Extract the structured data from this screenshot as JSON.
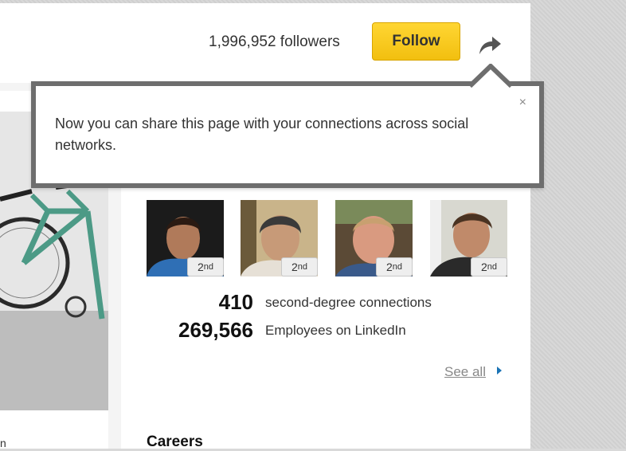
{
  "header": {
    "followers_text": "1,996,952 followers",
    "follow_label": "Follow",
    "share_icon": "share-arrow-icon"
  },
  "tooltip": {
    "message": "Now you can share this page with your connections across social networks.",
    "close_label": "×"
  },
  "connections": {
    "avatars": [
      {
        "badge_num": "2",
        "badge_suffix": "nd"
      },
      {
        "badge_num": "2",
        "badge_suffix": "nd"
      },
      {
        "badge_num": "2",
        "badge_suffix": "nd"
      },
      {
        "badge_num": "2",
        "badge_suffix": "nd"
      }
    ],
    "stats": [
      {
        "value": "410",
        "label": "second-degree connections"
      },
      {
        "value": "269,566",
        "label": "Employees on LinkedIn"
      }
    ],
    "see_all_label": "See all"
  },
  "careers": {
    "heading": "Careers"
  },
  "left_card": {
    "trailing_text": "n"
  },
  "colors": {
    "follow_button": "#f5c518",
    "tooltip_border": "#6e6e6e",
    "link_arrow": "#1a73b5"
  }
}
